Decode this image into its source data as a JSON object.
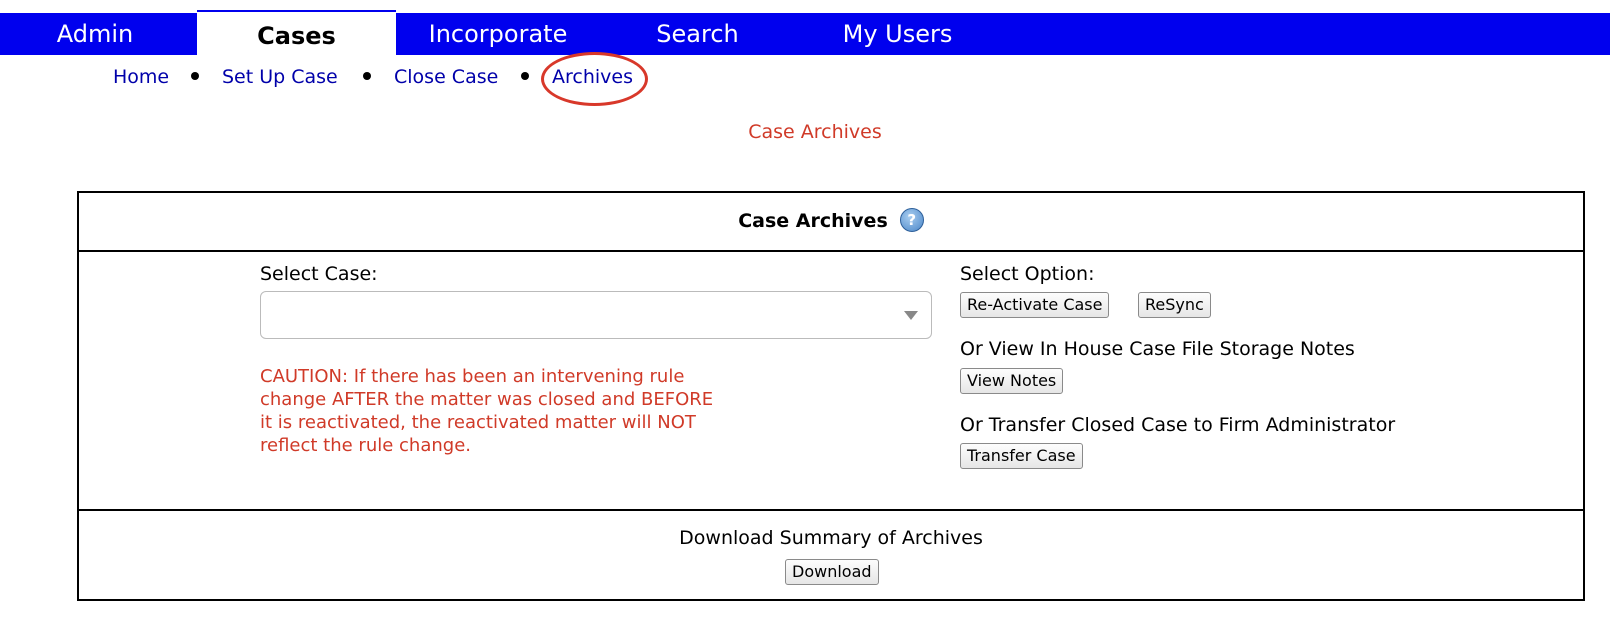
{
  "topnav": {
    "tabs": [
      {
        "label": "Admin"
      },
      {
        "label": "Cases"
      },
      {
        "label": "Incorporate"
      },
      {
        "label": "Search"
      },
      {
        "label": "My Users"
      }
    ]
  },
  "subnav": {
    "items": [
      {
        "label": "Home"
      },
      {
        "label": "Set Up Case"
      },
      {
        "label": "Close Case"
      },
      {
        "label": "Archives"
      }
    ]
  },
  "page": {
    "title": "Case Archives"
  },
  "panel": {
    "title": "Case Archives",
    "help_icon": "?",
    "select_case_label": "Select Case:",
    "select_case_value": "",
    "caution": "CAUTION: If there has been an intervening rule change AFTER the matter was closed and BEFORE it is reactivated, the reactivated matter will NOT reflect the rule change.",
    "select_option_label": "Select Option:",
    "reactivate_label": "Re-Activate Case",
    "resync_label": "ReSync",
    "view_notes_heading": "Or View In House Case File Storage Notes",
    "view_notes_label": "View Notes",
    "transfer_heading": "Or Transfer Closed Case to Firm Administrator",
    "transfer_label": "Transfer Case",
    "download_heading": "Download Summary of Archives",
    "download_label": "Download"
  },
  "colors": {
    "nav_blue": "#0000ee",
    "link_blue": "#0000aa",
    "alert_red": "#d03a28"
  }
}
